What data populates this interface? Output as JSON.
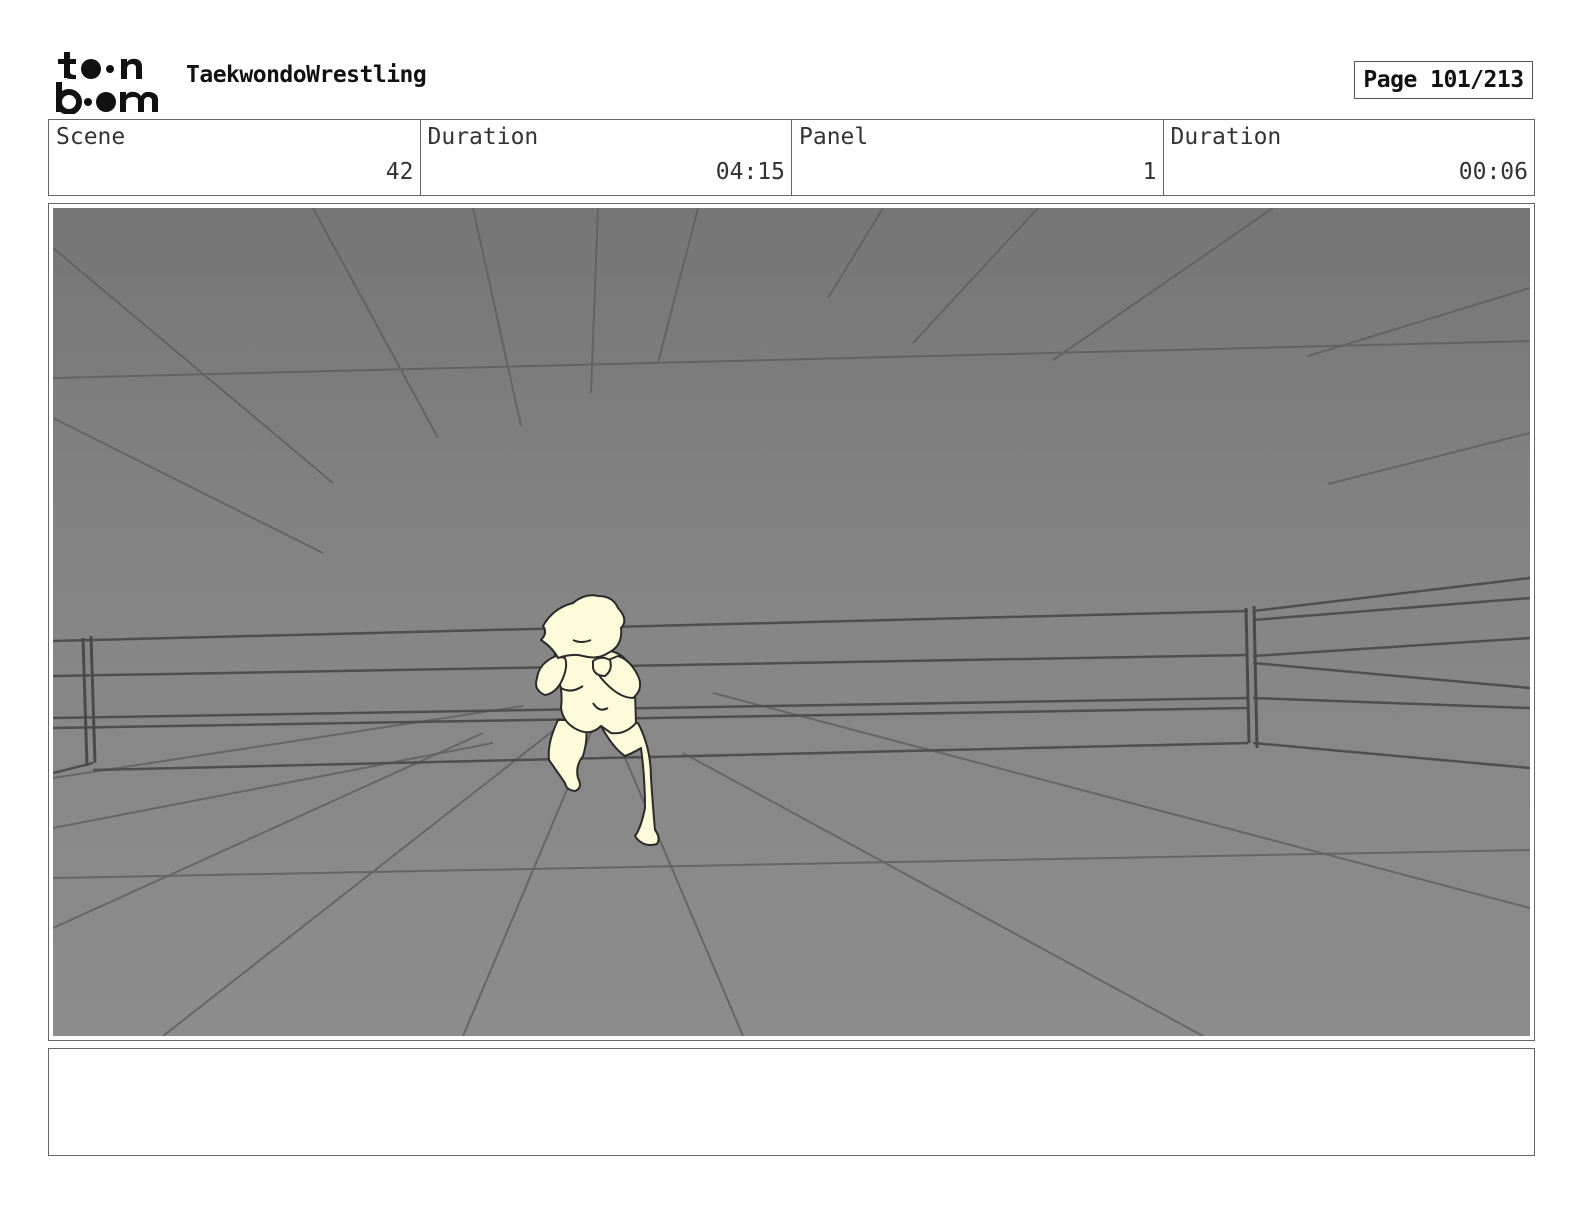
{
  "header": {
    "logo_text": "toon boom",
    "project_title": "TaekwondoWrestling",
    "page_indicator": "Page 101/213"
  },
  "info": {
    "scene_label": "Scene",
    "scene_value": "42",
    "scene_duration_label": "Duration",
    "scene_duration_value": "04:15",
    "panel_label": "Panel",
    "panel_value": "1",
    "panel_duration_label": "Duration",
    "panel_duration_value": "00:06"
  },
  "panel": {
    "description": "",
    "background_color": "#858585",
    "figure_color": "#fdfbd9"
  },
  "notes": {
    "text": ""
  }
}
